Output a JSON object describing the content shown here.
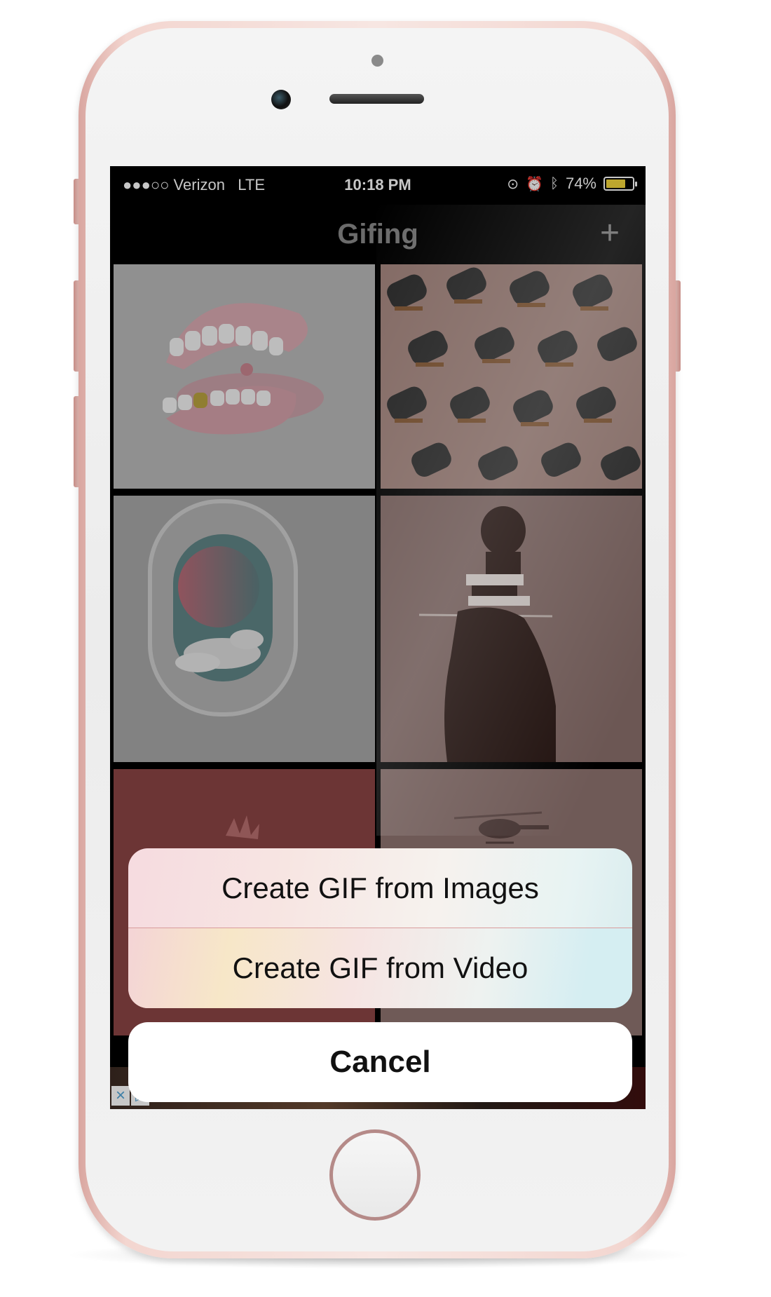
{
  "status_bar": {
    "carrier": "●●●○○ Verizon",
    "network": "LTE",
    "time": "10:18 PM",
    "battery_percent": "74%",
    "battery_level": 0.74
  },
  "nav": {
    "title": "Gifing",
    "add_icon": "plus-icon"
  },
  "grid": {
    "tiles": [
      {
        "subject": "teeth"
      },
      {
        "subject": "chairs"
      },
      {
        "subject": "airplane-window"
      },
      {
        "subject": "man-profile"
      },
      {
        "subject": "red-plant"
      },
      {
        "subject": "helicopter"
      }
    ]
  },
  "ad": {
    "close_icon": "close-icon",
    "info_icon": "adchoices-icon"
  },
  "action_sheet": {
    "option_images": "Create GIF from Images",
    "option_video": "Create GIF from Video",
    "cancel": "Cancel"
  },
  "colors": {
    "phone_rose_gold": "#f3d6d0",
    "battery": "#f2d53c",
    "nav_text": "#8a8a8a"
  }
}
